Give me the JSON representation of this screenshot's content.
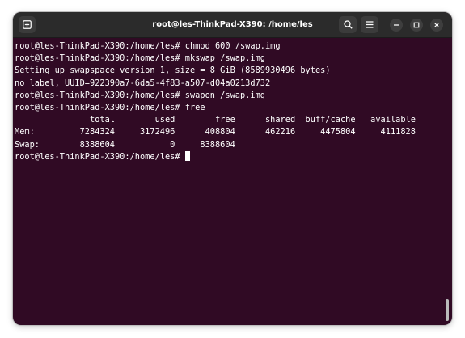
{
  "window": {
    "title": "root@les-ThinkPad-X390: /home/les"
  },
  "icons": {
    "new_tab": "new-tab-icon",
    "search": "search-icon",
    "menu": "hamburger-menu-icon",
    "minimize": "minimize-icon",
    "maximize": "maximize-icon",
    "close": "close-icon"
  },
  "colors": {
    "terminal_background": "#300a24",
    "titlebar_background": "#2b2b2b",
    "text": "#ffffff"
  },
  "terminal": {
    "lines": [
      "root@les-ThinkPad-X390:/home/les# chmod 600 /swap.img",
      "root@les-ThinkPad-X390:/home/les# mkswap /swap.img",
      "Setting up swapspace version 1, size = 8 GiB (8589930496 bytes)",
      "no label, UUID=922390a7-6da5-4f83-a507-d04a0213d732",
      "root@les-ThinkPad-X390:/home/les# swapon /swap.img",
      "root@les-ThinkPad-X390:/home/les# free",
      "               total        used        free      shared  buff/cache   available",
      "Mem:         7284324     3172496      408804      462216     4475804     4111828",
      "Swap:        8388604           0     8388604"
    ],
    "prompt": "root@les-ThinkPad-X390:/home/les# "
  }
}
